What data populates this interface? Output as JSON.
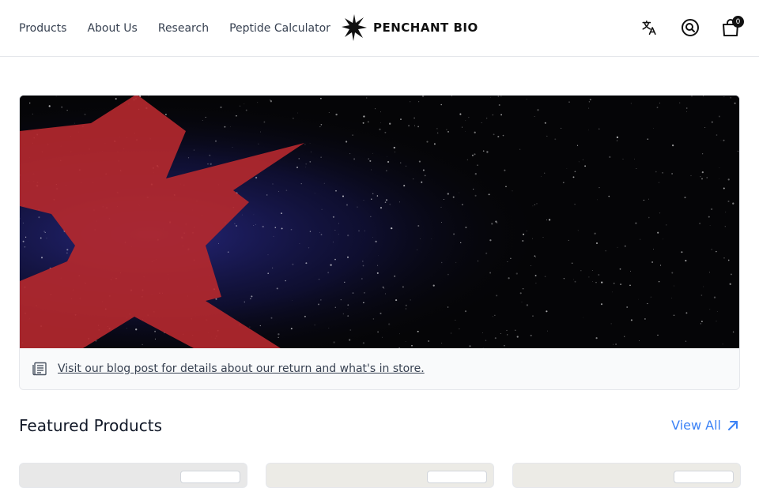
{
  "header": {
    "nav": [
      "Products",
      "About Us",
      "Research",
      "Peptide Calculator"
    ],
    "brand": "PENCHANT BIO",
    "icons": [
      "translate-icon",
      "search-icon",
      "cart-icon"
    ],
    "cart_count": "0"
  },
  "hero": {
    "note_text": "Visit our blog post for details about our return and what's in store."
  },
  "featured": {
    "title": "Featured Products",
    "view_all": "View All"
  },
  "colors": {
    "accent": "#3b82f6",
    "hero_star": "#b3282e",
    "space": "#050507"
  }
}
